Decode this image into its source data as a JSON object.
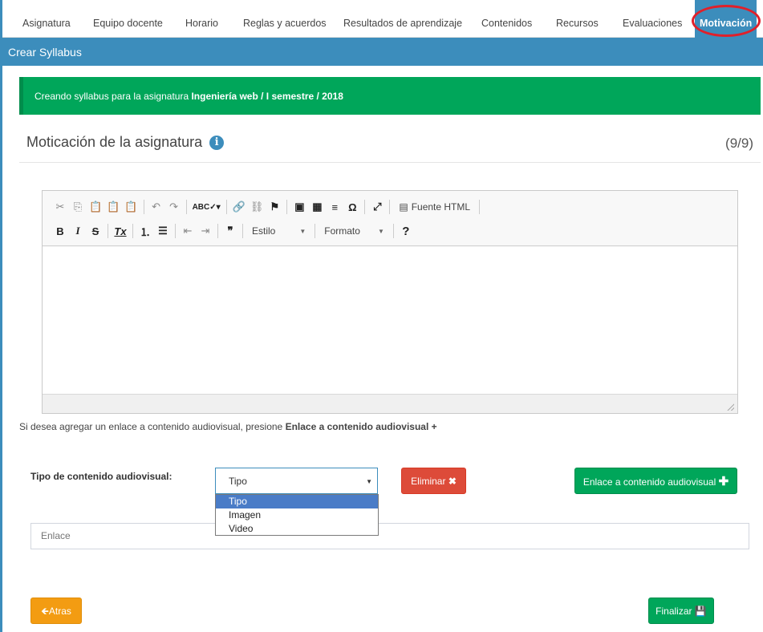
{
  "tabs": [
    {
      "label": "Asignatura",
      "active": false
    },
    {
      "label": "Equipo docente",
      "active": false
    },
    {
      "label": "Horario",
      "active": false
    },
    {
      "label": "Reglas y acuerdos",
      "active": false
    },
    {
      "label": "Resultados de aprendizaje",
      "active": false
    },
    {
      "label": "Contenidos",
      "active": false
    },
    {
      "label": "Recursos",
      "active": false
    },
    {
      "label": "Evaluaciones",
      "active": false
    },
    {
      "label": "Motivación",
      "active": true
    }
  ],
  "header": {
    "title": "Crear Syllabus"
  },
  "alert": {
    "prefix": "Creando syllabus para la asignatura ",
    "course": "Ingeniería web / I semestre / 2018"
  },
  "section": {
    "title": "Moticación de la asignatura",
    "counter": "(9/9)"
  },
  "editor": {
    "source_label": "Fuente HTML",
    "style_label": "Estilo",
    "format_label": "Formato"
  },
  "hint": {
    "text": "Si desea agregar un enlace a contenido audiovisual, presione ",
    "bold": "Enlace a contenido audiovisual +"
  },
  "form": {
    "tipo_label": "Tipo de contenido audiovisual:",
    "select_value": "Tipo",
    "options": [
      "Tipo",
      "Imagen",
      "Video"
    ],
    "enlace_placeholder": "Enlace"
  },
  "buttons": {
    "eliminar": "Eliminar",
    "enlace": "Enlace a contenido audiovisual",
    "atras": "Atras",
    "finalizar": "Finalizar"
  },
  "colors": {
    "primary": "#3c8dbc",
    "success": "#00a65a",
    "danger": "#dd4b39",
    "warning": "#f39c12",
    "highlight_circle": "#e0202a"
  }
}
